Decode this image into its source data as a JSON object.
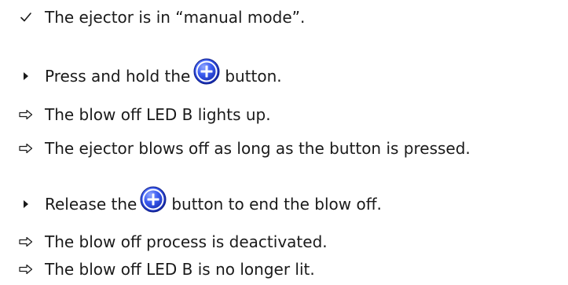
{
  "steps": [
    {
      "marker": "check-icon",
      "text": "The ejector is in “manual mode”."
    },
    {
      "marker": "triangle-bullet-icon",
      "before": "Press and hold the",
      "button_icon": "plus-button-icon",
      "after": "button."
    },
    {
      "marker": "result-arrow-icon",
      "text": "The blow off LED B lights up."
    },
    {
      "marker": "result-arrow-icon",
      "text": "The ejector blows off as long as the button is pressed."
    },
    {
      "marker": "triangle-bullet-icon",
      "before": "Release the",
      "button_icon": "plus-button-icon",
      "after": "button to end the blow off."
    },
    {
      "marker": "result-arrow-icon",
      "text": "The blow off process is deactivated."
    },
    {
      "marker": "result-arrow-icon",
      "text": "The blow off LED B is no longer lit."
    }
  ],
  "colors": {
    "text": "#1a1a1a",
    "button_blue": "#1f3fd0",
    "button_blue_light": "#5b7cff"
  }
}
